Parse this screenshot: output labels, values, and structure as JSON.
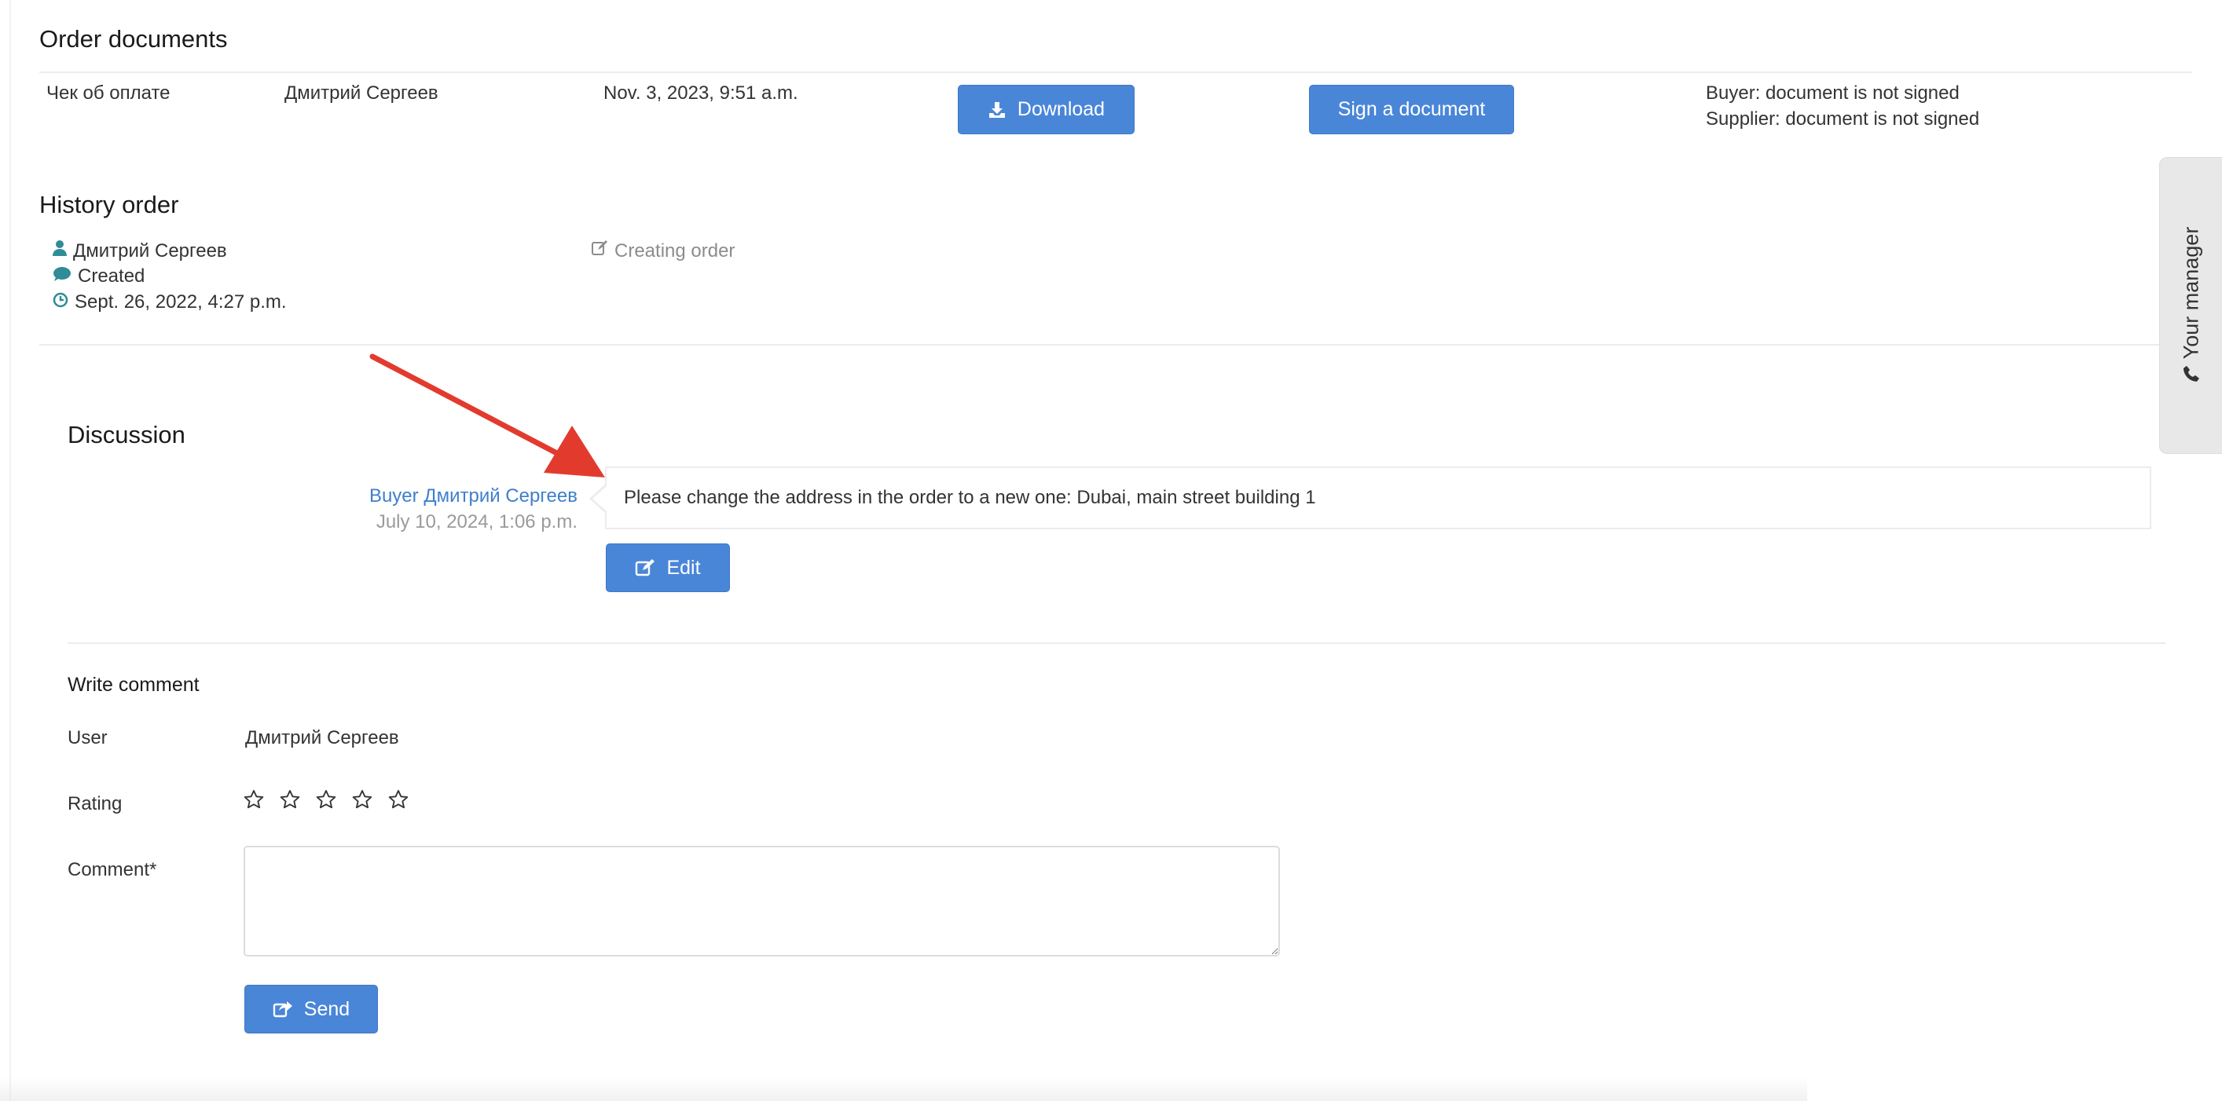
{
  "documents": {
    "title": "Order documents",
    "row": {
      "name": "Чек об оплате",
      "author": "Дмитрий Сергеев",
      "date": "Nov. 3, 2023, 9:51 a.m.",
      "download_label": "Download",
      "sign_label": "Sign a document",
      "buyer_status": "Buyer: document is not signed",
      "supplier_status": "Supplier: document is not signed"
    }
  },
  "history": {
    "title": "History order",
    "user": "Дмитрий Сергеев",
    "status": "Created",
    "date": "Sept. 26, 2022, 4:27 p.m.",
    "action": "Creating order"
  },
  "discussion": {
    "title": "Discussion",
    "message": {
      "author": "Buyer Дмитрий Сергеев",
      "date": "July 10, 2024, 1:06 p.m.",
      "text": "Please change the address in the order to a new one: Dubai, main street building 1",
      "edit_label": "Edit"
    }
  },
  "comment_form": {
    "title": "Write comment",
    "user_label": "User",
    "user_value": "Дмитрий Сергеев",
    "rating_label": "Rating",
    "rating_value": 0,
    "rating_max": 5,
    "comment_label": "Comment*",
    "comment_value": "",
    "send_label": "Send"
  },
  "side_tab": {
    "label": "Your manager"
  },
  "colors": {
    "primary_button": "#4a86d8",
    "link": "#3f7fcc",
    "history_icon": "#2f8c98",
    "annotation_arrow": "#e23b2e"
  }
}
